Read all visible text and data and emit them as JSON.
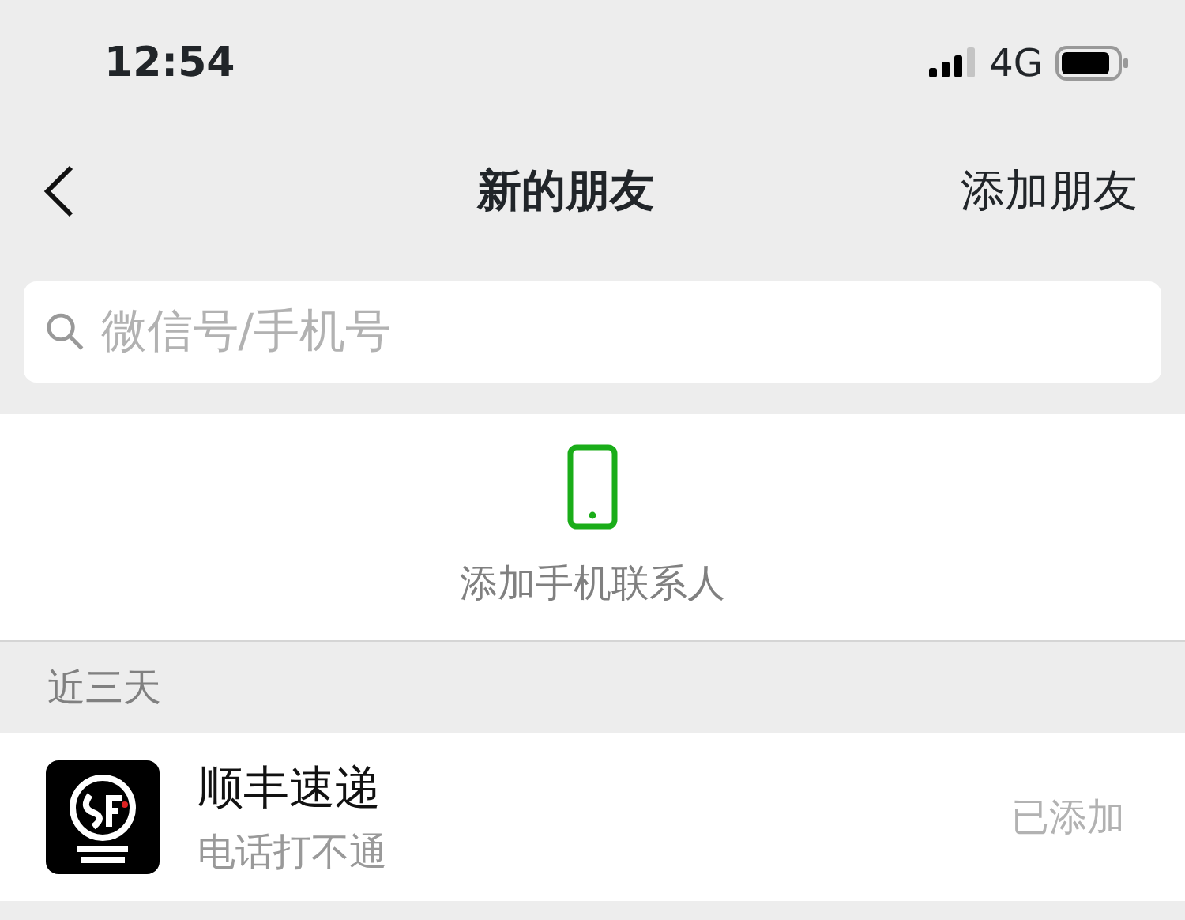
{
  "status_bar": {
    "time": "12:54",
    "network": "4G"
  },
  "nav": {
    "title": "新的朋友",
    "action": "添加朋友"
  },
  "search": {
    "placeholder": "微信号/手机号"
  },
  "add_contacts": {
    "label": "添加手机联系人"
  },
  "section": {
    "title": "近三天"
  },
  "friends": [
    {
      "name": "顺丰速递",
      "note": "电话打不通",
      "status": "已添加",
      "added": true
    }
  ]
}
